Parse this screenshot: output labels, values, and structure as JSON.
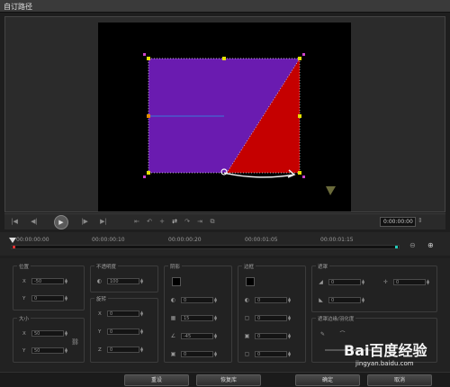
{
  "window": {
    "title": "自订路径"
  },
  "transport": {
    "timecode": "0:00:00:00",
    "buttons": [
      "home-icon",
      "prev-frame-icon",
      "play-icon",
      "next-frame-icon",
      "end-icon"
    ]
  },
  "timeline": {
    "ticks": [
      "00:00:00:00",
      "00:00:00:10",
      "00:00:00:20",
      "00:00:01:05",
      "00:00:01:15"
    ],
    "playhead_fraction": 0.0
  },
  "panels": {
    "position": {
      "title": "位置",
      "x_label": "X",
      "x_value": "-50",
      "y_label": "Y",
      "y_value": "0"
    },
    "size": {
      "title": "大小",
      "x_label": "X",
      "x_value": "50",
      "y_label": "Y",
      "y_value": "50"
    },
    "opacity": {
      "title": "不透明度",
      "value": "100"
    },
    "rotation": {
      "title": "旋转",
      "x_label": "X",
      "x_value": "0",
      "y_label": "Y",
      "y_value": "0",
      "z_label": "Z",
      "z_value": "0"
    },
    "shadow": {
      "title": "阴影",
      "v1": "0",
      "v2": "15",
      "v3": "-45",
      "v4": "0"
    },
    "border": {
      "title": "边框",
      "v1": "0",
      "v2": "0",
      "v3": "0",
      "v4": "0"
    },
    "blur": {
      "title": "遮罩",
      "v1": "0",
      "v2": "0",
      "v3": "0"
    },
    "feather": {
      "title": "遮罩边缘/羽化度"
    }
  },
  "footer": {
    "reset": "重设",
    "restore": "恢复库",
    "ok": "确定",
    "cancel": "取消"
  },
  "watermark": {
    "brand": "Bai百度经验",
    "url": "jingyan.baidu.com"
  },
  "colors": {
    "purple": "#6a1bb0",
    "red": "#c50000",
    "handle": "#e5e000",
    "corner": "#cc44cc"
  }
}
